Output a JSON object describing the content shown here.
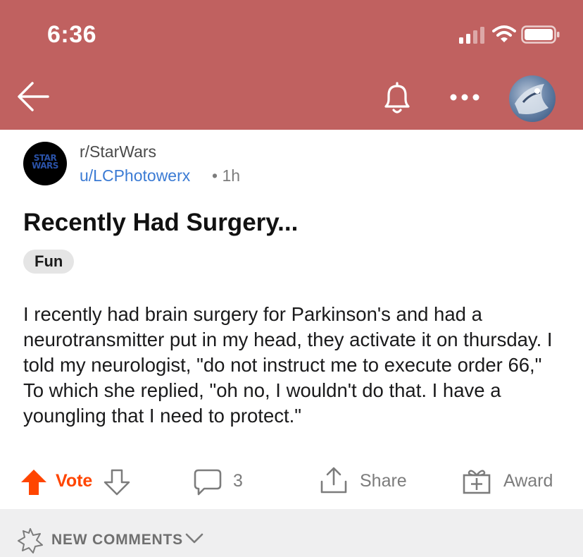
{
  "status_bar": {
    "time": "6:36",
    "icons": [
      "signal-icon",
      "wifi-icon",
      "battery-icon"
    ]
  },
  "nav": {
    "icons": [
      "back-arrow-icon",
      "bell-icon",
      "more-icon"
    ],
    "header_color": "#c06160"
  },
  "post": {
    "subreddit": "r/StarWars",
    "subreddit_icon_text": "STAR WARS",
    "username": "u/LCPhotowerx",
    "separator": "•",
    "age": "1h",
    "title": "Recently Had Surgery...",
    "flair": "Fun",
    "body": "I recently had brain surgery for Parkinson's and had a neurotransmitter put in my head, they activate it on thursday. I told my neurologist, \"do not instruct me to execute order 66,\" To which she replied, \"oh no, I wouldn't do that. I have a youngling that I need to protect.\""
  },
  "actions": {
    "vote_label": "Vote",
    "comment_count": "3",
    "share_label": "Share",
    "award_label": "Award",
    "upvote_color": "#ff4500"
  },
  "footer": {
    "new_comments_label": "NEW COMMENTS"
  }
}
